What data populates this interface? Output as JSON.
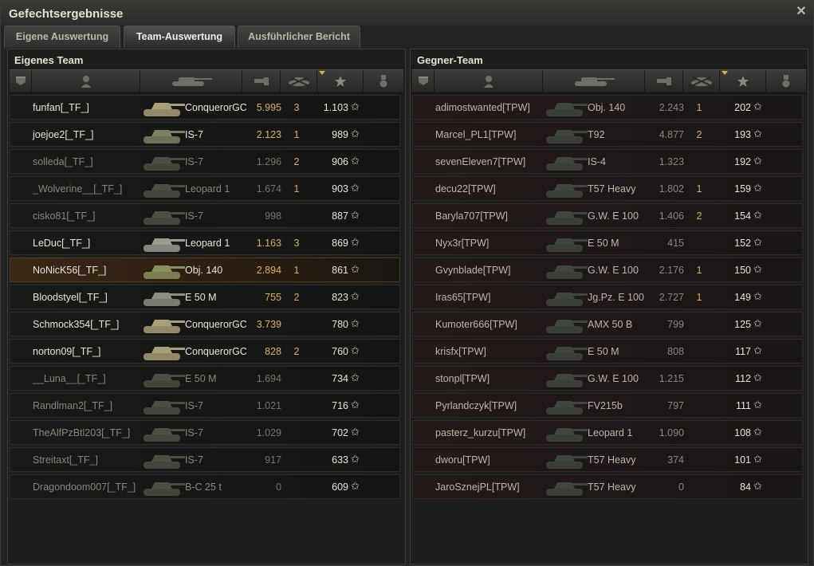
{
  "window": {
    "title": "Gefechtsergebnisse"
  },
  "tabs": [
    "Eigene Auswertung",
    "Team-Auswertung",
    "Ausführlicher Bericht"
  ],
  "left_panel": {
    "title": "Eigenes Team",
    "rows": [
      {
        "name": "funfan[_TF_]",
        "tank": "ConquerorGC",
        "damage": "5.995",
        "kills": "3",
        "xp": "1.103",
        "dead": false,
        "self": false,
        "tank_color": "#a89e78"
      },
      {
        "name": "joejoe2[_TF_]",
        "tank": "IS-7",
        "damage": "2.123",
        "kills": "1",
        "xp": "989",
        "dead": false,
        "self": false,
        "tank_color": "#7a8262"
      },
      {
        "name": "solleda[_TF_]",
        "tank": "IS-7",
        "damage": "1.296",
        "kills": "2",
        "xp": "906",
        "dead": true,
        "self": false,
        "tank_color": "#4a4f42"
      },
      {
        "name": "_Wolverine__[_TF_]",
        "tank": "Leopard 1",
        "damage": "1.674",
        "kills": "1",
        "xp": "903",
        "dead": true,
        "self": false,
        "tank_color": "#4a4f42"
      },
      {
        "name": "cisko81[_TF_]",
        "tank": "IS-7",
        "damage": "998",
        "kills": "",
        "xp": "887",
        "dead": true,
        "self": false,
        "tank_color": "#4a4f42"
      },
      {
        "name": "LeDuc[_TF_]",
        "tank": "Leopard 1",
        "damage": "1.163",
        "kills": "3",
        "xp": "869",
        "dead": false,
        "self": false,
        "tank_color": "#9a9a8e"
      },
      {
        "name": "NoNicK56[_TF_]",
        "tank": "Obj. 140",
        "damage": "2.894",
        "kills": "1",
        "xp": "861",
        "dead": false,
        "self": true,
        "tank_color": "#8a8f5e"
      },
      {
        "name": "Bloodstyel[_TF_]",
        "tank": "E 50 M",
        "damage": "755",
        "kills": "2",
        "xp": "823",
        "dead": false,
        "self": false,
        "tank_color": "#8c8c82"
      },
      {
        "name": "Schmock354[_TF_]",
        "tank": "ConquerorGC",
        "damage": "3.739",
        "kills": "",
        "xp": "780",
        "dead": false,
        "self": false,
        "tank_color": "#a89e78"
      },
      {
        "name": "norton09[_TF_]",
        "tank": "ConquerorGC",
        "damage": "828",
        "kills": "2",
        "xp": "760",
        "dead": false,
        "self": false,
        "tank_color": "#a89e78"
      },
      {
        "name": "__Luna__[_TF_]",
        "tank": "E 50 M",
        "damage": "1.694",
        "kills": "",
        "xp": "734",
        "dead": true,
        "self": false,
        "tank_color": "#4a4f42"
      },
      {
        "name": "Randlman2[_TF_]",
        "tank": "IS-7",
        "damage": "1.021",
        "kills": "",
        "xp": "716",
        "dead": true,
        "self": false,
        "tank_color": "#4a4f42"
      },
      {
        "name": "TheAlfPzBtl203[_TF_]",
        "tank": "IS-7",
        "damage": "1.029",
        "kills": "",
        "xp": "702",
        "dead": true,
        "self": false,
        "tank_color": "#4a4f42"
      },
      {
        "name": "Streitaxt[_TF_]",
        "tank": "IS-7",
        "damage": "917",
        "kills": "",
        "xp": "633",
        "dead": true,
        "self": false,
        "tank_color": "#4a4f42"
      },
      {
        "name": "Dragondoom007[_TF_]",
        "tank": "B-C 25 t",
        "damage": "0",
        "kills": "",
        "xp": "609",
        "dead": true,
        "self": false,
        "tank_color": "#4a4f42"
      }
    ]
  },
  "right_panel": {
    "title": "Gegner-Team",
    "rows": [
      {
        "name": "adimostwanted[TPW]",
        "tank": "Obj. 140",
        "damage": "2.243",
        "kills": "1",
        "xp": "202",
        "dead": false,
        "self": false,
        "tank_color": "#3f463e"
      },
      {
        "name": "Marcel_PL1[TPW]",
        "tank": "T92",
        "damage": "4.877",
        "kills": "2",
        "xp": "193",
        "dead": false,
        "self": false,
        "tank_color": "#3f463e"
      },
      {
        "name": "sevenEleven7[TPW]",
        "tank": "IS-4",
        "damage": "1.323",
        "kills": "",
        "xp": "192",
        "dead": false,
        "self": false,
        "tank_color": "#3f463e"
      },
      {
        "name": "decu22[TPW]",
        "tank": "T57 Heavy",
        "damage": "1.802",
        "kills": "1",
        "xp": "159",
        "dead": false,
        "self": false,
        "tank_color": "#3f463e"
      },
      {
        "name": "Baryla707[TPW]",
        "tank": "G.W. E 100",
        "damage": "1.406",
        "kills": "2",
        "xp": "154",
        "dead": false,
        "self": false,
        "tank_color": "#3f463e"
      },
      {
        "name": "Nyx3r[TPW]",
        "tank": "E 50 M",
        "damage": "415",
        "kills": "",
        "xp": "152",
        "dead": false,
        "self": false,
        "tank_color": "#3f463e"
      },
      {
        "name": "Gvynblade[TPW]",
        "tank": "G.W. E 100",
        "damage": "2.176",
        "kills": "1",
        "xp": "150",
        "dead": false,
        "self": false,
        "tank_color": "#3f463e"
      },
      {
        "name": "Iras65[TPW]",
        "tank": "Jg.Pz. E 100",
        "damage": "2.727",
        "kills": "1",
        "xp": "149",
        "dead": false,
        "self": false,
        "tank_color": "#3f463e"
      },
      {
        "name": "Kumoter666[TPW]",
        "tank": "AMX 50 B",
        "damage": "799",
        "kills": "",
        "xp": "125",
        "dead": false,
        "self": false,
        "tank_color": "#3f463e"
      },
      {
        "name": "krisfx[TPW]",
        "tank": "E 50 M",
        "damage": "808",
        "kills": "",
        "xp": "117",
        "dead": false,
        "self": false,
        "tank_color": "#3f463e"
      },
      {
        "name": "stonpl[TPW]",
        "tank": "G.W. E 100",
        "damage": "1.215",
        "kills": "",
        "xp": "112",
        "dead": false,
        "self": false,
        "tank_color": "#3f463e"
      },
      {
        "name": "Pyrlandczyk[TPW]",
        "tank": "FV215b",
        "damage": "797",
        "kills": "",
        "xp": "111",
        "dead": false,
        "self": false,
        "tank_color": "#3f463e"
      },
      {
        "name": "pasterz_kurzu[TPW]",
        "tank": "Leopard 1",
        "damage": "1.090",
        "kills": "",
        "xp": "108",
        "dead": false,
        "self": false,
        "tank_color": "#3f463e"
      },
      {
        "name": "dworu[TPW]",
        "tank": "T57 Heavy",
        "damage": "374",
        "kills": "",
        "xp": "101",
        "dead": false,
        "self": false,
        "tank_color": "#3f463e"
      },
      {
        "name": "JaroSznejPL[TPW]",
        "tank": "T57 Heavy",
        "damage": "0",
        "kills": "",
        "xp": "84",
        "dead": false,
        "self": false,
        "tank_color": "#3f463e"
      }
    ]
  },
  "columns": {
    "squad_icon": "squad-icon",
    "player_icon": "player-icon",
    "tank_icon": "tank-icon",
    "damage_icon": "damage-icon",
    "kills_icon": "kills-icon",
    "xp_icon": "star-icon",
    "medal_icon": "medal-icon",
    "sorted_column": "xp"
  },
  "glyphs": {
    "star": "✩",
    "close": "✕"
  }
}
